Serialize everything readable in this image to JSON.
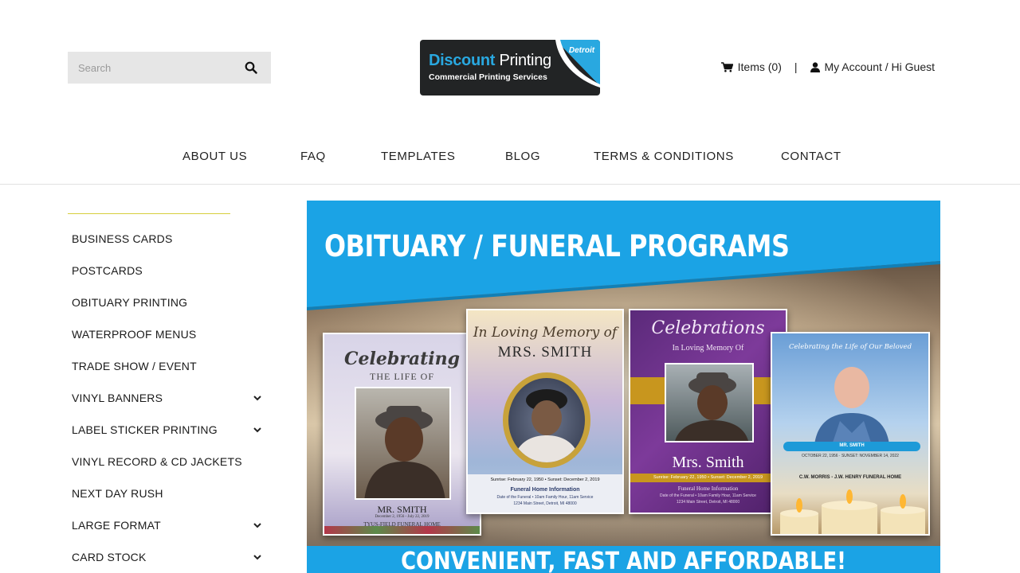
{
  "header": {
    "search_placeholder": "Search",
    "logo": {
      "word1": "Discount",
      "word2": "Printing",
      "tagline": "Commercial Printing Services",
      "corner": "Detroit"
    },
    "cart_label": "Items (0)",
    "separator": "|",
    "account_label": "My Account / Hi Guest"
  },
  "nav": [
    "ABOUT US",
    "FAQ",
    "TEMPLATES",
    "BLOG",
    "TERMS & CONDITIONS",
    "CONTACT"
  ],
  "sidebar": {
    "items": [
      {
        "label": "BUSINESS CARDS",
        "expandable": false
      },
      {
        "label": "POSTCARDS",
        "expandable": false
      },
      {
        "label": "OBITUARY PRINTING",
        "expandable": false
      },
      {
        "label": "WATERPROOF MENUS",
        "expandable": false
      },
      {
        "label": "TRADE SHOW / EVENT",
        "expandable": false
      },
      {
        "label": "VINYL BANNERS",
        "expandable": true
      },
      {
        "label": "LABEL STICKER PRINTING",
        "expandable": true
      },
      {
        "label": "VINYL RECORD & CD JACKETS",
        "expandable": false
      },
      {
        "label": "NEXT DAY RUSH",
        "expandable": false
      },
      {
        "label": "LARGE FORMAT",
        "expandable": true
      },
      {
        "label": "CARD STOCK",
        "expandable": true
      }
    ]
  },
  "banner": {
    "title": "OBITUARY / FUNERAL PROGRAMS",
    "bottom_text": "CONVENIENT, FAST AND AFFORDABLE!",
    "cards": [
      {
        "heading": "Celebrating",
        "subheading": "THE LIFE OF",
        "name": "MR. SMITH",
        "dates": "December 2, 1956 - July 22, 2019",
        "home": "TYUS-FIELD FUNERAL HOME"
      },
      {
        "heading": "In Loving Memory of",
        "name": "MRS. SMITH",
        "dates": "Sunrise: February 22, 1950 • Sunset: December 2, 2019",
        "home": "Funeral Home Information",
        "detail": "Date of the Funeral • 10am Family Hour, 11am Service",
        "address": "1234 Main Street, Detroit, MI 48000"
      },
      {
        "heading": "Celebrations",
        "subheading": "In Loving Memory Of",
        "name": "Mrs. Smith",
        "dates": "Sunrise: February 22, 1950 • Sunset: December 2, 2019",
        "home": "Funeral Home Information",
        "detail": "Date of the Funeral • 10am Family Hour, 11am Service",
        "address": "1234 Main Street, Detroit, MI 48000"
      },
      {
        "heading": "Celebrating the Life of Our Beloved",
        "name": "MR. SMITH",
        "dates": "OCTOBER 22, 1956 · SUNSET: NOVEMBER 14, 2022",
        "home": "C.W. MORRIS - J.W. HENRY FUNERAL HOME"
      }
    ]
  },
  "colors": {
    "accent_line": "#d7cf3c",
    "banner_blue": "#1ba3e5",
    "logo_blue": "#29a8e0"
  }
}
